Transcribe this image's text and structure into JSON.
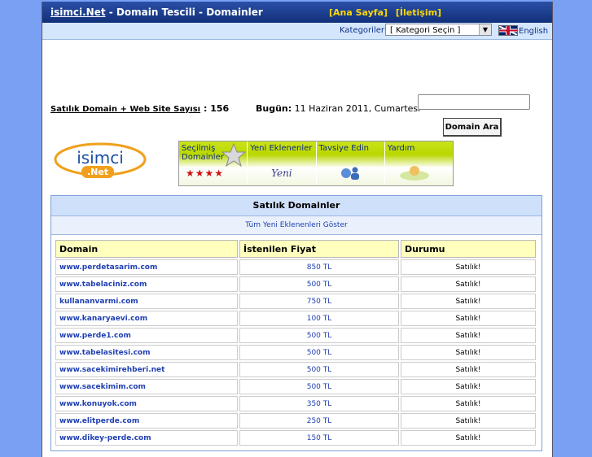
{
  "header": {
    "site": "isimci.Net",
    "title_rest": " - Domain Tescili - Domainler",
    "link_home": "[Ana Sayfa]",
    "link_contact": "[İletişim]"
  },
  "category_bar": {
    "label": "Kategoriler:",
    "select_value": "[ Kategori Seçin ]",
    "lang": "English"
  },
  "info": {
    "stat_label": "Satılık Domain + Web Site Sayısı",
    "stat_value": ": 156",
    "date_label": "Bugün:",
    "date_value": " 11 Haziran 2011, Cumartesi",
    "search_value": "",
    "search_button": "Domain Ara"
  },
  "logo": {
    "text_top": "isimci",
    "text_bottom": ".Net"
  },
  "menu": {
    "items": [
      {
        "label": "Seçilmiş Domainler",
        "sub": "★★★★"
      },
      {
        "label": "Yeni Eklenenler",
        "sub": "Yeni"
      },
      {
        "label": "Tavsiye Edin",
        "sub": ""
      },
      {
        "label": "Yardım",
        "sub": ""
      }
    ]
  },
  "section": {
    "title": "Satılık Domainler",
    "show_all": "Tüm Yeni Eklenenleri Göster",
    "columns": [
      "Domain",
      "İstenilen Fiyat",
      "Durumu"
    ],
    "rows": [
      [
        "www.perdetasarim.com",
        "850 TL",
        "Satılık!"
      ],
      [
        "www.tabelaciniz.com",
        "500 TL",
        "Satılık!"
      ],
      [
        "kullananvarmi.com",
        "750 TL",
        "Satılık!"
      ],
      [
        "www.kanaryaevi.com",
        "100 TL",
        "Satılık!"
      ],
      [
        "www.perde1.com",
        "500 TL",
        "Satılık!"
      ],
      [
        "www.tabelasitesi.com",
        "500 TL",
        "Satılık!"
      ],
      [
        "www.sacekimirehberi.net",
        "500 TL",
        "Satılık!"
      ],
      [
        "www.sacekimim.com",
        "500 TL",
        "Satılık!"
      ],
      [
        "www.konuyok.com",
        "350 TL",
        "Satılık!"
      ],
      [
        "www.elitperde.com",
        "250 TL",
        "Satılık!"
      ],
      [
        "www.dikey-perde.com",
        "150 TL",
        "Satılık!"
      ]
    ]
  }
}
